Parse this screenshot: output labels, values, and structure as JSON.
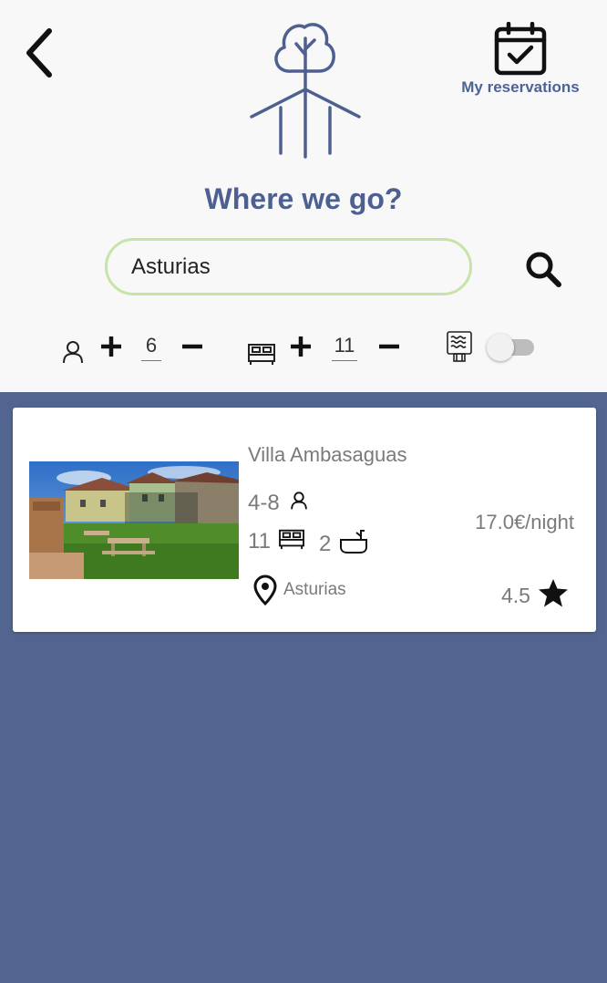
{
  "header": {
    "my_reservations_label": "My reservations",
    "title": "Where we go?"
  },
  "search": {
    "value": "Asturias"
  },
  "filters": {
    "guests_count": "6",
    "beds_count": "11",
    "toggle_on": false
  },
  "results": [
    {
      "name": "Villa Ambasaguas",
      "guests_range": "4-8",
      "beds": "11",
      "baths": "2",
      "price": "17.0€/night",
      "location": "Asturias",
      "rating": "4.5"
    }
  ],
  "colors": {
    "primary": "#4d6090",
    "list_background": "#516590",
    "search_border": "#c7e3a8",
    "header_background": "#f8f8f8"
  },
  "icons": {
    "back": "chevron-left-icon",
    "reservations": "calendar-check-icon",
    "logo": "tree-icon",
    "search": "magnifier-icon",
    "guests": "person-icon",
    "beds": "bed-icon",
    "extra_filter": "document-icon",
    "baths": "bathtub-icon",
    "location": "map-pin-icon",
    "rating": "star-icon"
  }
}
